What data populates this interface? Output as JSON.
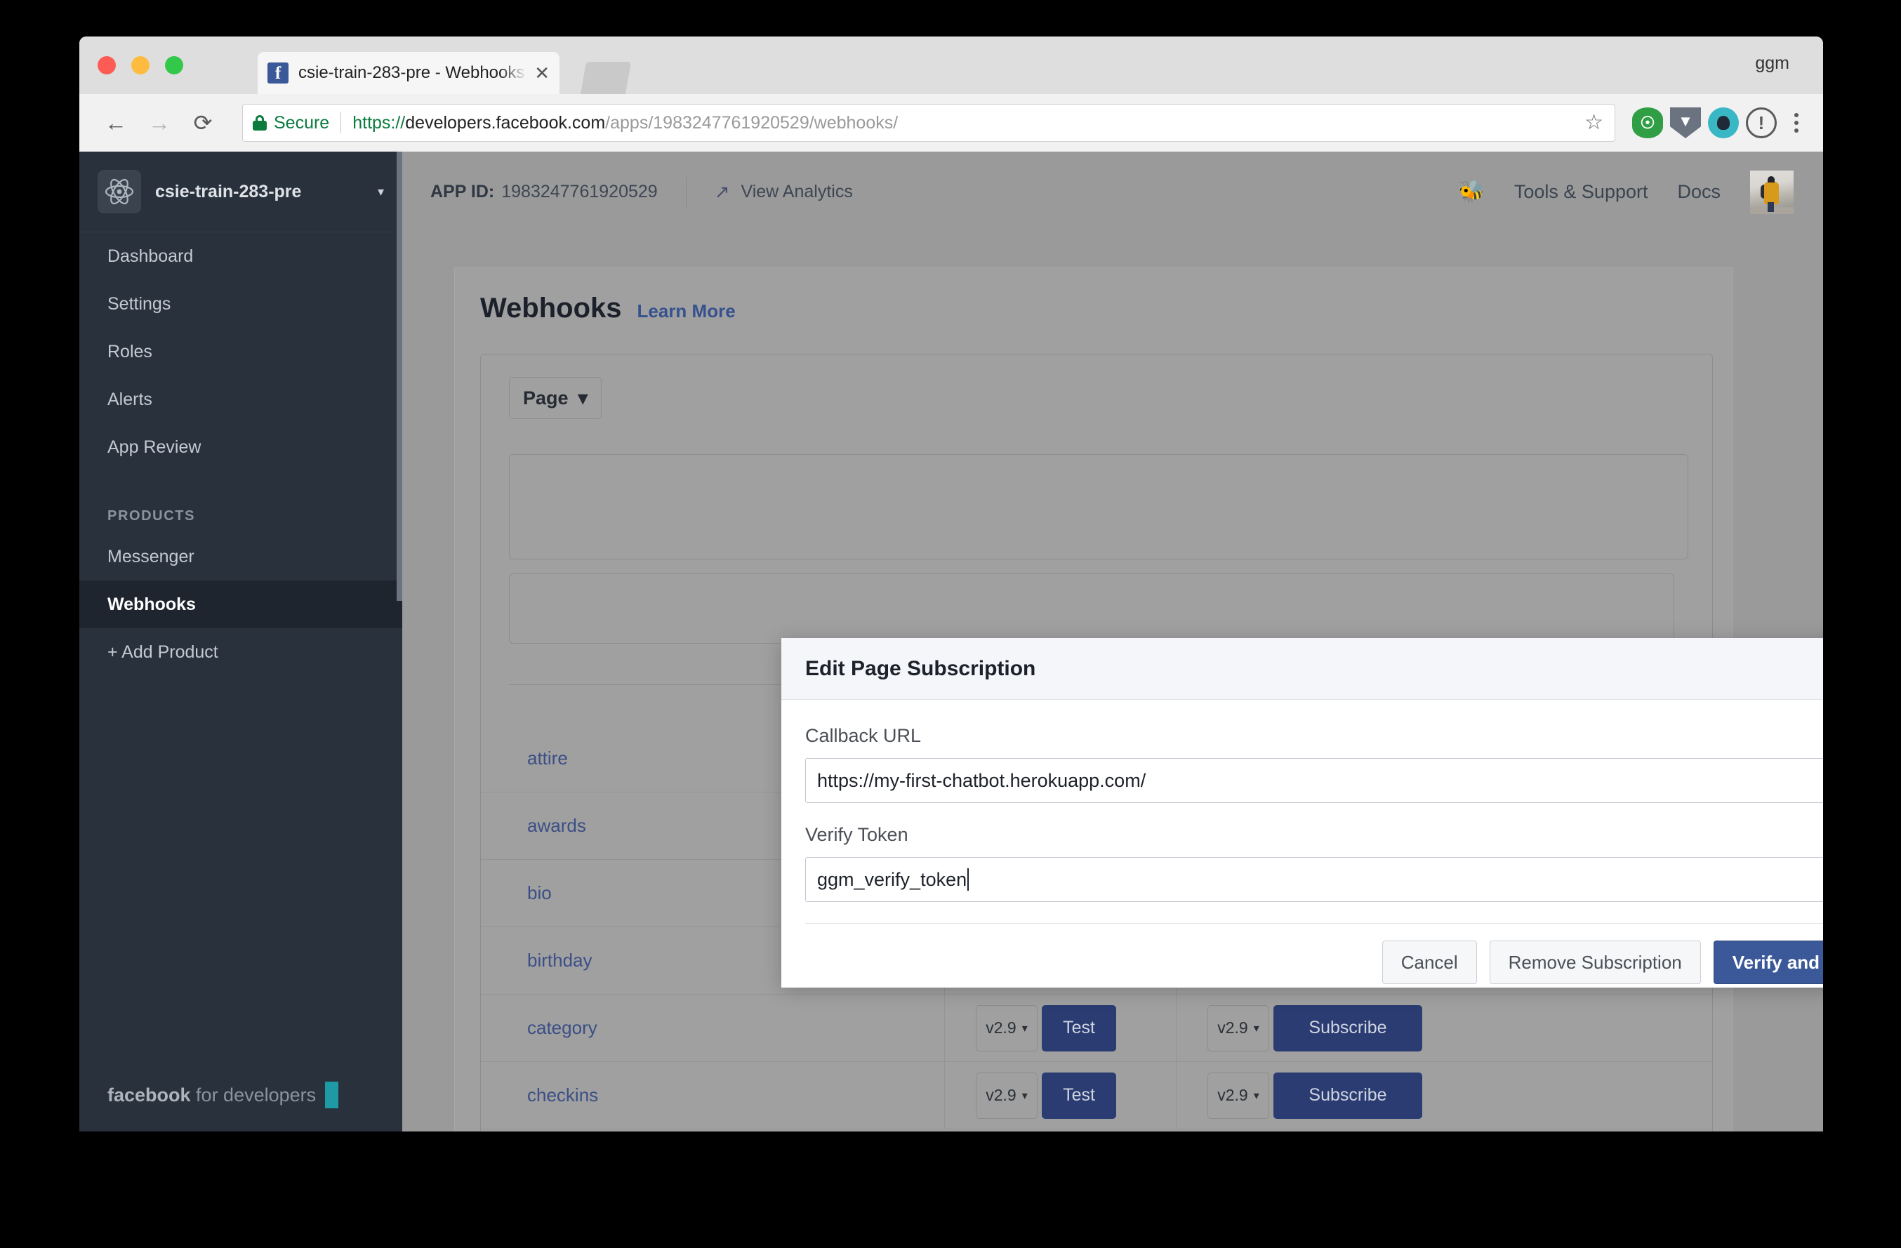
{
  "browser": {
    "tab": {
      "title": "csie-train-283-pre - Webhooks",
      "favicon_letter": "f",
      "close_icon": "close-icon"
    },
    "profile_name": "ggm",
    "toolbar": {
      "back_icon": "←",
      "forward_icon": "→",
      "reload_icon": "⟳",
      "security_label": "Secure",
      "lock_icon": "lock-icon",
      "url_scheme": "https://",
      "url_host": "developers.facebook.com",
      "url_path": "/apps/1983247761920529/webhooks/",
      "star_icon": "☆",
      "extensions": [
        "1password-icon",
        "dashlane-icon",
        "pocket-icon",
        "info-icon"
      ],
      "menu_icon": "kebab-menu-icon"
    }
  },
  "sidebar": {
    "app_name": "csie-train-283-pre",
    "app_icon": "atom-icon",
    "caret_icon": "▾",
    "items": [
      {
        "label": "Dashboard",
        "active": false
      },
      {
        "label": "Settings",
        "active": false
      },
      {
        "label": "Roles",
        "active": false
      },
      {
        "label": "Alerts",
        "active": false
      },
      {
        "label": "App Review",
        "active": false
      }
    ],
    "section_label": "PRODUCTS",
    "products": [
      {
        "label": "Messenger",
        "active": false
      },
      {
        "label": "Webhooks",
        "active": true
      },
      {
        "label": "+ Add Product",
        "active": false
      }
    ],
    "footer": {
      "brand_bold": "facebook",
      "brand_rest": " for developers"
    }
  },
  "header": {
    "app_id_label": "APP ID:",
    "app_id_value": "1983247761920529",
    "analytics_label": "View Analytics",
    "analytics_icon": "trend-up-icon",
    "bug_icon": "bug-icon",
    "tools_label": "Tools & Support",
    "docs_label": "Docs",
    "avatar": "user-avatar"
  },
  "main": {
    "page_title": "Webhooks",
    "learn_more": "Learn More",
    "object_dropdown": {
      "label": "Page",
      "caret": "▾"
    },
    "table": {
      "version_value": "v2.9",
      "caret": "▾",
      "test_label": "Test",
      "subscribe_label": "Subscribe",
      "rows": [
        {
          "field": "attire"
        },
        {
          "field": "awards"
        },
        {
          "field": "bio"
        },
        {
          "field": "birthday"
        },
        {
          "field": "category"
        },
        {
          "field": "checkins"
        }
      ]
    }
  },
  "modal": {
    "title": "Edit Page Subscription",
    "close_icon": "close-icon",
    "callback_url_label": "Callback URL",
    "callback_url_value": "https://my-first-chatbot.herokuapp.com/",
    "verify_token_label": "Verify Token",
    "verify_token_value": "ggm_verify_token",
    "buttons": {
      "cancel": "Cancel",
      "remove": "Remove Subscription",
      "save": "Verify and Save"
    }
  },
  "colors": {
    "fb_blue": "#3b5998",
    "sidebar_bg": "#29313c",
    "table_btn": "#2b3c72",
    "secure_green": "#0b7b3e",
    "teal_accent": "#1d9aa3"
  }
}
